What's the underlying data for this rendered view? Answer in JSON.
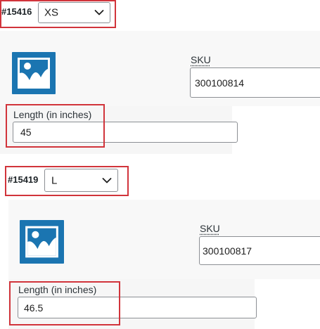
{
  "variations": [
    {
      "id_label": "#15416",
      "size_selected": "XS",
      "sku_label": "SKU",
      "sku_value": "300100814",
      "length_label": "Length (in inches)",
      "length_value": "45"
    },
    {
      "id_label": "#15419",
      "size_selected": "L",
      "sku_label": "SKU",
      "sku_value": "300100817",
      "length_label": "Length (in inches)",
      "length_value": "46.5"
    }
  ],
  "colors": {
    "highlight": "#d1343b",
    "image_placeholder": "#1b75b1",
    "panel_background": "#f8f8f8"
  },
  "icons": {
    "image_placeholder": "image-placeholder-icon",
    "dropdown": "chevron-down-icon"
  }
}
